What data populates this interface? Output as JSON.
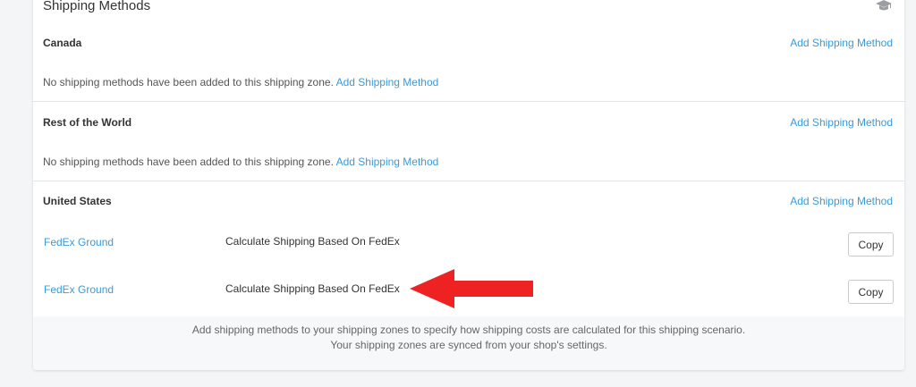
{
  "card": {
    "title": "Shipping Methods",
    "help_icon": "graduation-cap-icon"
  },
  "zones": [
    {
      "name": "Canada",
      "add_label": "Add Shipping Method",
      "empty_text": "No shipping methods have been added to this shipping zone.",
      "empty_link": "Add Shipping Method"
    },
    {
      "name": "Rest of the World",
      "add_label": "Add Shipping Method",
      "empty_text": "No shipping methods have been added to this shipping zone.",
      "empty_link": "Add Shipping Method"
    },
    {
      "name": "United States",
      "add_label": "Add Shipping Method",
      "methods": [
        {
          "name": "FedEx Ground",
          "description": "Calculate Shipping Based On FedEx",
          "copy_label": "Copy"
        },
        {
          "name": "FedEx Ground",
          "description": "Calculate Shipping Based On FedEx",
          "copy_label": "Copy"
        }
      ]
    }
  ],
  "footer": {
    "line1": "Add shipping methods to your shipping zones to specify how shipping costs are calculated for this shipping scenario.",
    "line2": "Your shipping zones are synced from your shop's settings."
  },
  "colors": {
    "link": "#3a9ad9",
    "arrow": "#ee2222"
  },
  "annotation": {
    "arrow_icon": "left-arrow-icon"
  }
}
